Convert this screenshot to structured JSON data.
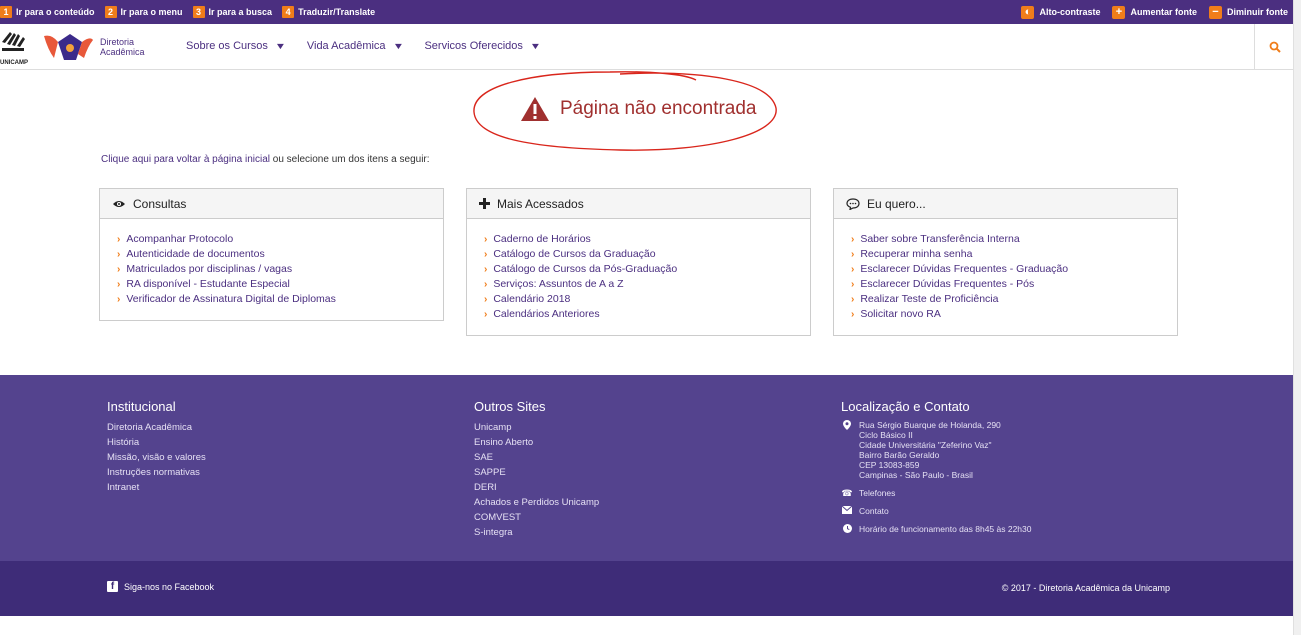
{
  "access_bar": {
    "left_items": [
      {
        "num": "1",
        "label": "Ir para o conteúdo"
      },
      {
        "num": "2",
        "label": "Ir para o menu"
      },
      {
        "num": "3",
        "label": "Ir para a busca"
      },
      {
        "num": "4",
        "label": "Traduzir/Translate"
      }
    ],
    "right_items": [
      {
        "icon": "contrast-icon",
        "label": "Alto-contraste"
      },
      {
        "icon": "plus-icon",
        "label": "Aumentar fonte"
      },
      {
        "icon": "minus-icon",
        "label": "Diminuir fonte"
      }
    ]
  },
  "header": {
    "unicamp_logo_text": "UNICAMP",
    "dac_text_line1": "Diretoria",
    "dac_text_line2": "Acadêmica",
    "nav": [
      {
        "label": "Sobre os Cursos"
      },
      {
        "label": "Vida Acadêmica"
      },
      {
        "label": "Servicos Oferecidos"
      }
    ]
  },
  "error": {
    "title": "Página não encontrada"
  },
  "intro": {
    "link": "Clique aqui para voltar à página inicial",
    "rest": " ou selecione um dos itens a seguir:"
  },
  "boxes": [
    {
      "title": "Consultas",
      "icon": "eye-icon",
      "items": [
        "Acompanhar Protocolo",
        "Autenticidade de documentos",
        "Matriculados por disciplinas / vagas",
        "RA disponível - Estudante Especial",
        "Verificador de Assinatura Digital de Diplomas"
      ]
    },
    {
      "title": "Mais Acessados",
      "icon": "plus-icon",
      "items": [
        "Caderno de Horários",
        "Catálogo de Cursos da Graduação",
        "Catálogo de Cursos da Pós-Graduação",
        "Serviços: Assuntos de A a Z",
        "Calendário 2018",
        "Calendários Anteriores"
      ]
    },
    {
      "title": "Eu quero...",
      "icon": "speech-bubble-icon",
      "items": [
        "Saber sobre Transferência Interna",
        "Recuperar minha senha",
        "Esclarecer Dúvidas Frequentes - Graduação",
        "Esclarecer Dúvidas Frequentes - Pós",
        "Realizar Teste de Proficiência",
        "Solicitar novo RA"
      ]
    }
  ],
  "footer": {
    "institucional": {
      "title": "Institucional",
      "links": [
        "Diretoria Acadêmica",
        "História",
        "Missão, visão e valores",
        "Instruções normativas",
        "Intranet"
      ]
    },
    "outros": {
      "title": "Outros Sites",
      "links": [
        "Unicamp",
        "Ensino Aberto",
        "SAE",
        "SAPPE",
        "DERI",
        "Achados e Perdidos Unicamp",
        "COMVEST",
        "S-integra"
      ]
    },
    "contato": {
      "title": "Localização e Contato",
      "address": [
        "Rua Sérgio Buarque de Holanda, 290",
        "Ciclo Básico II",
        "Cidade Universitária \"Zeferino Vaz\"",
        "Bairro Barão Geraldo",
        "CEP 13083-859",
        "Campinas - São Paulo - Brasil"
      ],
      "phones": "Telefones",
      "contact": "Contato",
      "hours": "Horário de funcionamento das 8h45 às 22h30"
    }
  },
  "footer_bottom": {
    "facebook": "Siga-nos no Facebook",
    "copyright": "© 2017 - Diretoria Acadêmica da Unicamp"
  },
  "colors": {
    "brand_purple": "#4b2f80",
    "accent_orange": "#f07d1a",
    "error_red": "#a0302f",
    "footer": "#54438e",
    "footer_bottom": "#3e2c78"
  }
}
